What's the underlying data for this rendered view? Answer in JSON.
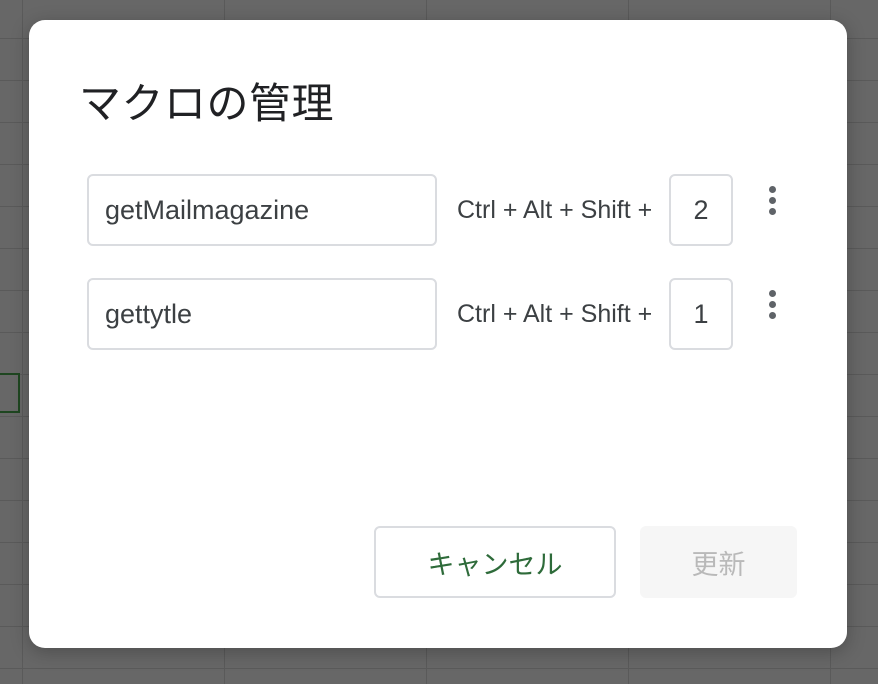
{
  "dialog": {
    "title": "マクロの管理",
    "macros": [
      {
        "name": "getMailmagazine",
        "shortcut_prefix": "Ctrl + Alt + Shift +",
        "key": "2",
        "more_icon": "more-vert-icon"
      },
      {
        "name": "gettytle",
        "shortcut_prefix": "Ctrl + Alt + Shift +",
        "key": "1",
        "more_icon": "more-vert-icon"
      }
    ],
    "buttons": {
      "cancel_label": "キャンセル",
      "update_label": "更新",
      "update_enabled": false
    }
  },
  "colors": {
    "accent_green": "#2e6b3a",
    "disabled_text": "#b9b9b9",
    "overlay": "#676767"
  }
}
